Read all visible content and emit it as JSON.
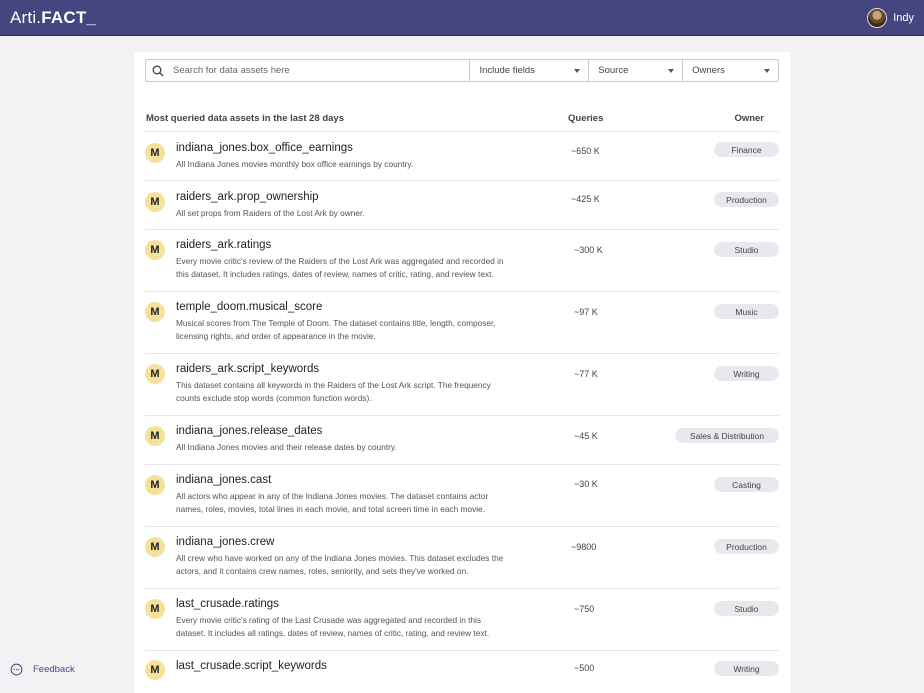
{
  "app": {
    "logo_part1": "Arti.",
    "logo_part2": "FACT_"
  },
  "user": {
    "name": "Indy"
  },
  "search": {
    "placeholder": "Search for data assets here"
  },
  "filters": {
    "include": "Include fields",
    "source": "Source",
    "owners": "Owners"
  },
  "table": {
    "title": "Most queried data assets in the last 28 days",
    "queries_header": "Queries",
    "owner_header": "Owner",
    "rows": [
      {
        "badge": "M",
        "name": "indiana_jones.box_office_earnings",
        "desc": "All Indiana Jones movies monthly box office earnings by country.",
        "queries": "~650 K",
        "owner": "Finance"
      },
      {
        "badge": "M",
        "name": "raiders_ark.prop_ownership",
        "desc": "All set props from Raiders of the Lost Ark by owner.",
        "queries": "~425 K",
        "owner": "Production"
      },
      {
        "badge": "M",
        "name": "raiders_ark.ratings",
        "desc": "Every movie critic's review of the Raiders of the Lost Ark was aggregated and recorded in this dataset. It includes ratings, dates of review, names of critic, rating, and review text.",
        "queries": "~300 K",
        "owner": "Studio"
      },
      {
        "badge": "M",
        "name": "temple_doom.musical_score",
        "desc": "Musical scores from The Temple of Doom. The dataset contains title, length, composer, licensing rights, and order of appearance in the movie.",
        "queries": "~97 K",
        "owner": "Music"
      },
      {
        "badge": "M",
        "name": "raiders_ark.script_keywords",
        "desc": "This dataset contains all keywords in the Raiders of the Lost Ark script. The frequency counts exclude stop words (common function words).",
        "queries": "~77 K",
        "owner": "Writing"
      },
      {
        "badge": "M",
        "name": "indiana_jones.release_dates",
        "desc": "All Indiana Jones movies and their release dates by country.",
        "queries": "~45 K",
        "owner": "Sales & Distribution"
      },
      {
        "badge": "M",
        "name": "indiana_jones.cast",
        "desc": "All actors who appear in any of the Indiana Jones movies. The dataset contains actor names, roles, movies, total lines in each movie, and total screen time in each movie.",
        "queries": "~30 K",
        "owner": "Casting"
      },
      {
        "badge": "M",
        "name": "indiana_jones.crew",
        "desc": "All crew who have worked on any of the Indiana Jones movies. This dataset excludes the actors, and it contains crew names, roles, seniority, and sets they've worked on.",
        "queries": "~9800",
        "owner": "Production"
      },
      {
        "badge": "M",
        "name": "last_crusade.ratings",
        "desc": "Every movie critic's rating of the Last Crusade was aggregated and recorded in this dataset. It includes all ratings, dates of review, names of critic, rating, and review text.",
        "queries": "~750",
        "owner": "Studio"
      },
      {
        "badge": "M",
        "name": "last_crusade.script_keywords",
        "desc": "",
        "queries": "~500",
        "owner": "Writing"
      }
    ]
  },
  "feedback": {
    "label": "Feedback"
  }
}
